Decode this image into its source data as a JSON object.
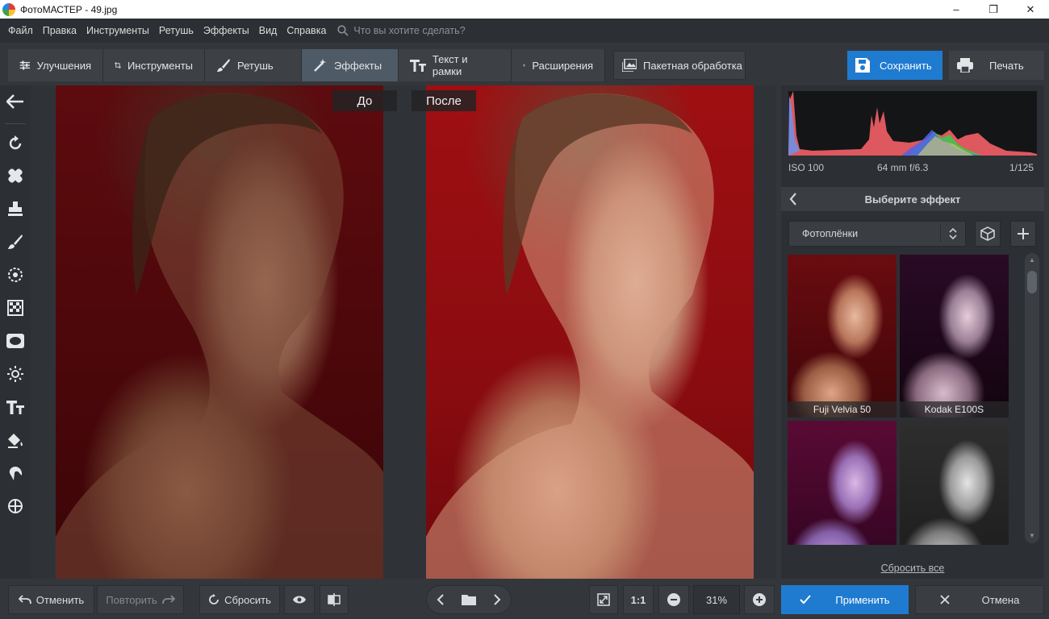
{
  "window": {
    "title": "ФотоМАСТЕР - 49.jpg",
    "controls": {
      "minimize": "–",
      "maximize": "❐",
      "close": "✕"
    }
  },
  "menu": {
    "items": [
      "Файл",
      "Правка",
      "Инструменты",
      "Ретушь",
      "Эффекты",
      "Вид",
      "Справка"
    ],
    "search_placeholder": "Что вы хотите сделать?"
  },
  "toolbar": {
    "tabs": [
      {
        "label": "Улучшения",
        "icon": "sliders-icon",
        "active": false
      },
      {
        "label": "Инструменты",
        "icon": "crop-icon",
        "active": false
      },
      {
        "label": "Ретушь",
        "icon": "brush-icon",
        "active": false
      },
      {
        "label": "Эффекты",
        "icon": "magic-wand-icon",
        "active": true
      },
      {
        "label": "Текст и рамки",
        "icon": "text-icon",
        "active": false
      },
      {
        "label": "Расширения",
        "icon": "plus-icon",
        "active": false
      }
    ],
    "batch_label": "Пакетная обработка",
    "save_label": "Сохранить",
    "print_label": "Печать"
  },
  "left_tools": [
    "back-arrow-icon",
    "rotate-icon",
    "healing-icon",
    "stamp-icon",
    "brush-icon",
    "radial-icon",
    "gradient-icon",
    "vignette-icon",
    "light-icon",
    "text-icon",
    "fill-icon",
    "liquify-icon",
    "target-icon"
  ],
  "canvas": {
    "before_label": "До",
    "after_label": "После"
  },
  "histogram": {
    "iso": "ISO 100",
    "lens": "64 mm f/6.3",
    "shutter": "1/125"
  },
  "effects_panel": {
    "title": "Выберите эффект",
    "category": "Фотоплёнки",
    "thumbnails": [
      {
        "label": "Fuji Velvia 50"
      },
      {
        "label": "Kodak E100S"
      },
      {
        "label": ""
      },
      {
        "label": ""
      }
    ],
    "reset_all": "Сбросить все"
  },
  "bottom": {
    "undo_label": "Отменить",
    "redo_label": "Повторить",
    "reset_label": "Сбросить",
    "ratio_label": "1:1",
    "zoom": "31%",
    "apply_label": "Применить",
    "cancel_label": "Отмена"
  },
  "colors": {
    "accent": "#1f7bd0",
    "panel": "#2c2f33",
    "active_tab": "#4e5a66"
  }
}
